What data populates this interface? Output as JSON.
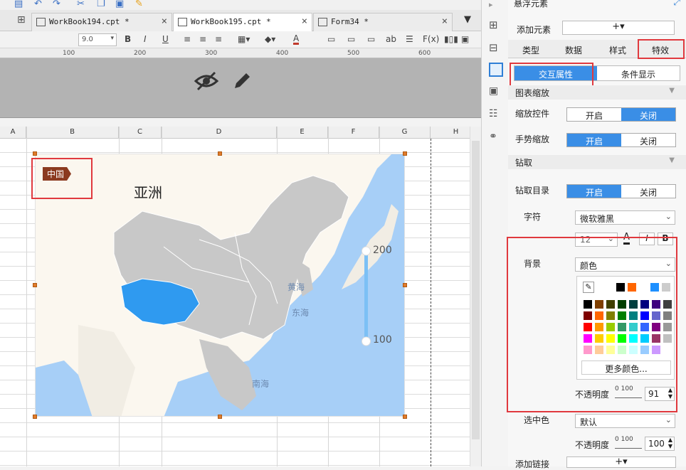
{
  "tabs": [
    {
      "label": "WorkBook194.cpt *",
      "close": "×"
    },
    {
      "label": "WorkBook195.cpt *",
      "close": "×"
    },
    {
      "label": "Form34 *",
      "close": "×"
    }
  ],
  "format_bar": {
    "font_size": "9.0",
    "bold": "B",
    "italic": "I",
    "underline": "U",
    "formula": "F(x)",
    "ab": "ab",
    "font_color": "A"
  },
  "ruler": [
    "100",
    "200",
    "300",
    "400",
    "500",
    "600"
  ],
  "columns": [
    "A",
    "B",
    "C",
    "D",
    "E",
    "F",
    "G",
    "H"
  ],
  "map": {
    "legend_tag": "中国",
    "region_title": "亚洲",
    "labels": {
      "yellow_sea": "黄海",
      "east_sea": "东海",
      "south_sea": "南海"
    },
    "scale": {
      "max": "200",
      "min": "100"
    },
    "colors": {
      "ocean": "#a7cff7",
      "land_gray": "#c8c8c8",
      "highlight": "#2f9af0",
      "background": "#fbf7ef"
    }
  },
  "panel": {
    "header": "悬浮元素",
    "add_element": "添加元素",
    "add_plus": "+▾",
    "tabs": [
      "类型",
      "数据",
      "样式",
      "特效"
    ],
    "subtabs": [
      "交互属性",
      "条件显示"
    ],
    "sec_zoom": "图表缩放",
    "zoom_ctrl": "缩放控件",
    "gesture_zoom": "手势缩放",
    "sec_drill": "钻取",
    "drill_dir": "钻取目录",
    "on": "开启",
    "off": "关闭",
    "font_label": "字符",
    "font_value": "微软雅黑",
    "font_size": "12",
    "font_a": "A",
    "font_i": "I",
    "font_b": "B",
    "bg_label": "背景",
    "bg_value": "颜色",
    "more_colors": "更多颜色...",
    "opacity_label": "不透明度",
    "opacity_scale": "0  100",
    "opacity_value": "91",
    "selected_color_label": "选中色",
    "selected_color_value": "默认",
    "opacity2_label": "不透明度",
    "opacity2_scale": "0  100",
    "opacity2_value": "100",
    "add_link": "添加链接",
    "add_link_plus": "+▾",
    "accent": "#3a8ee6"
  }
}
